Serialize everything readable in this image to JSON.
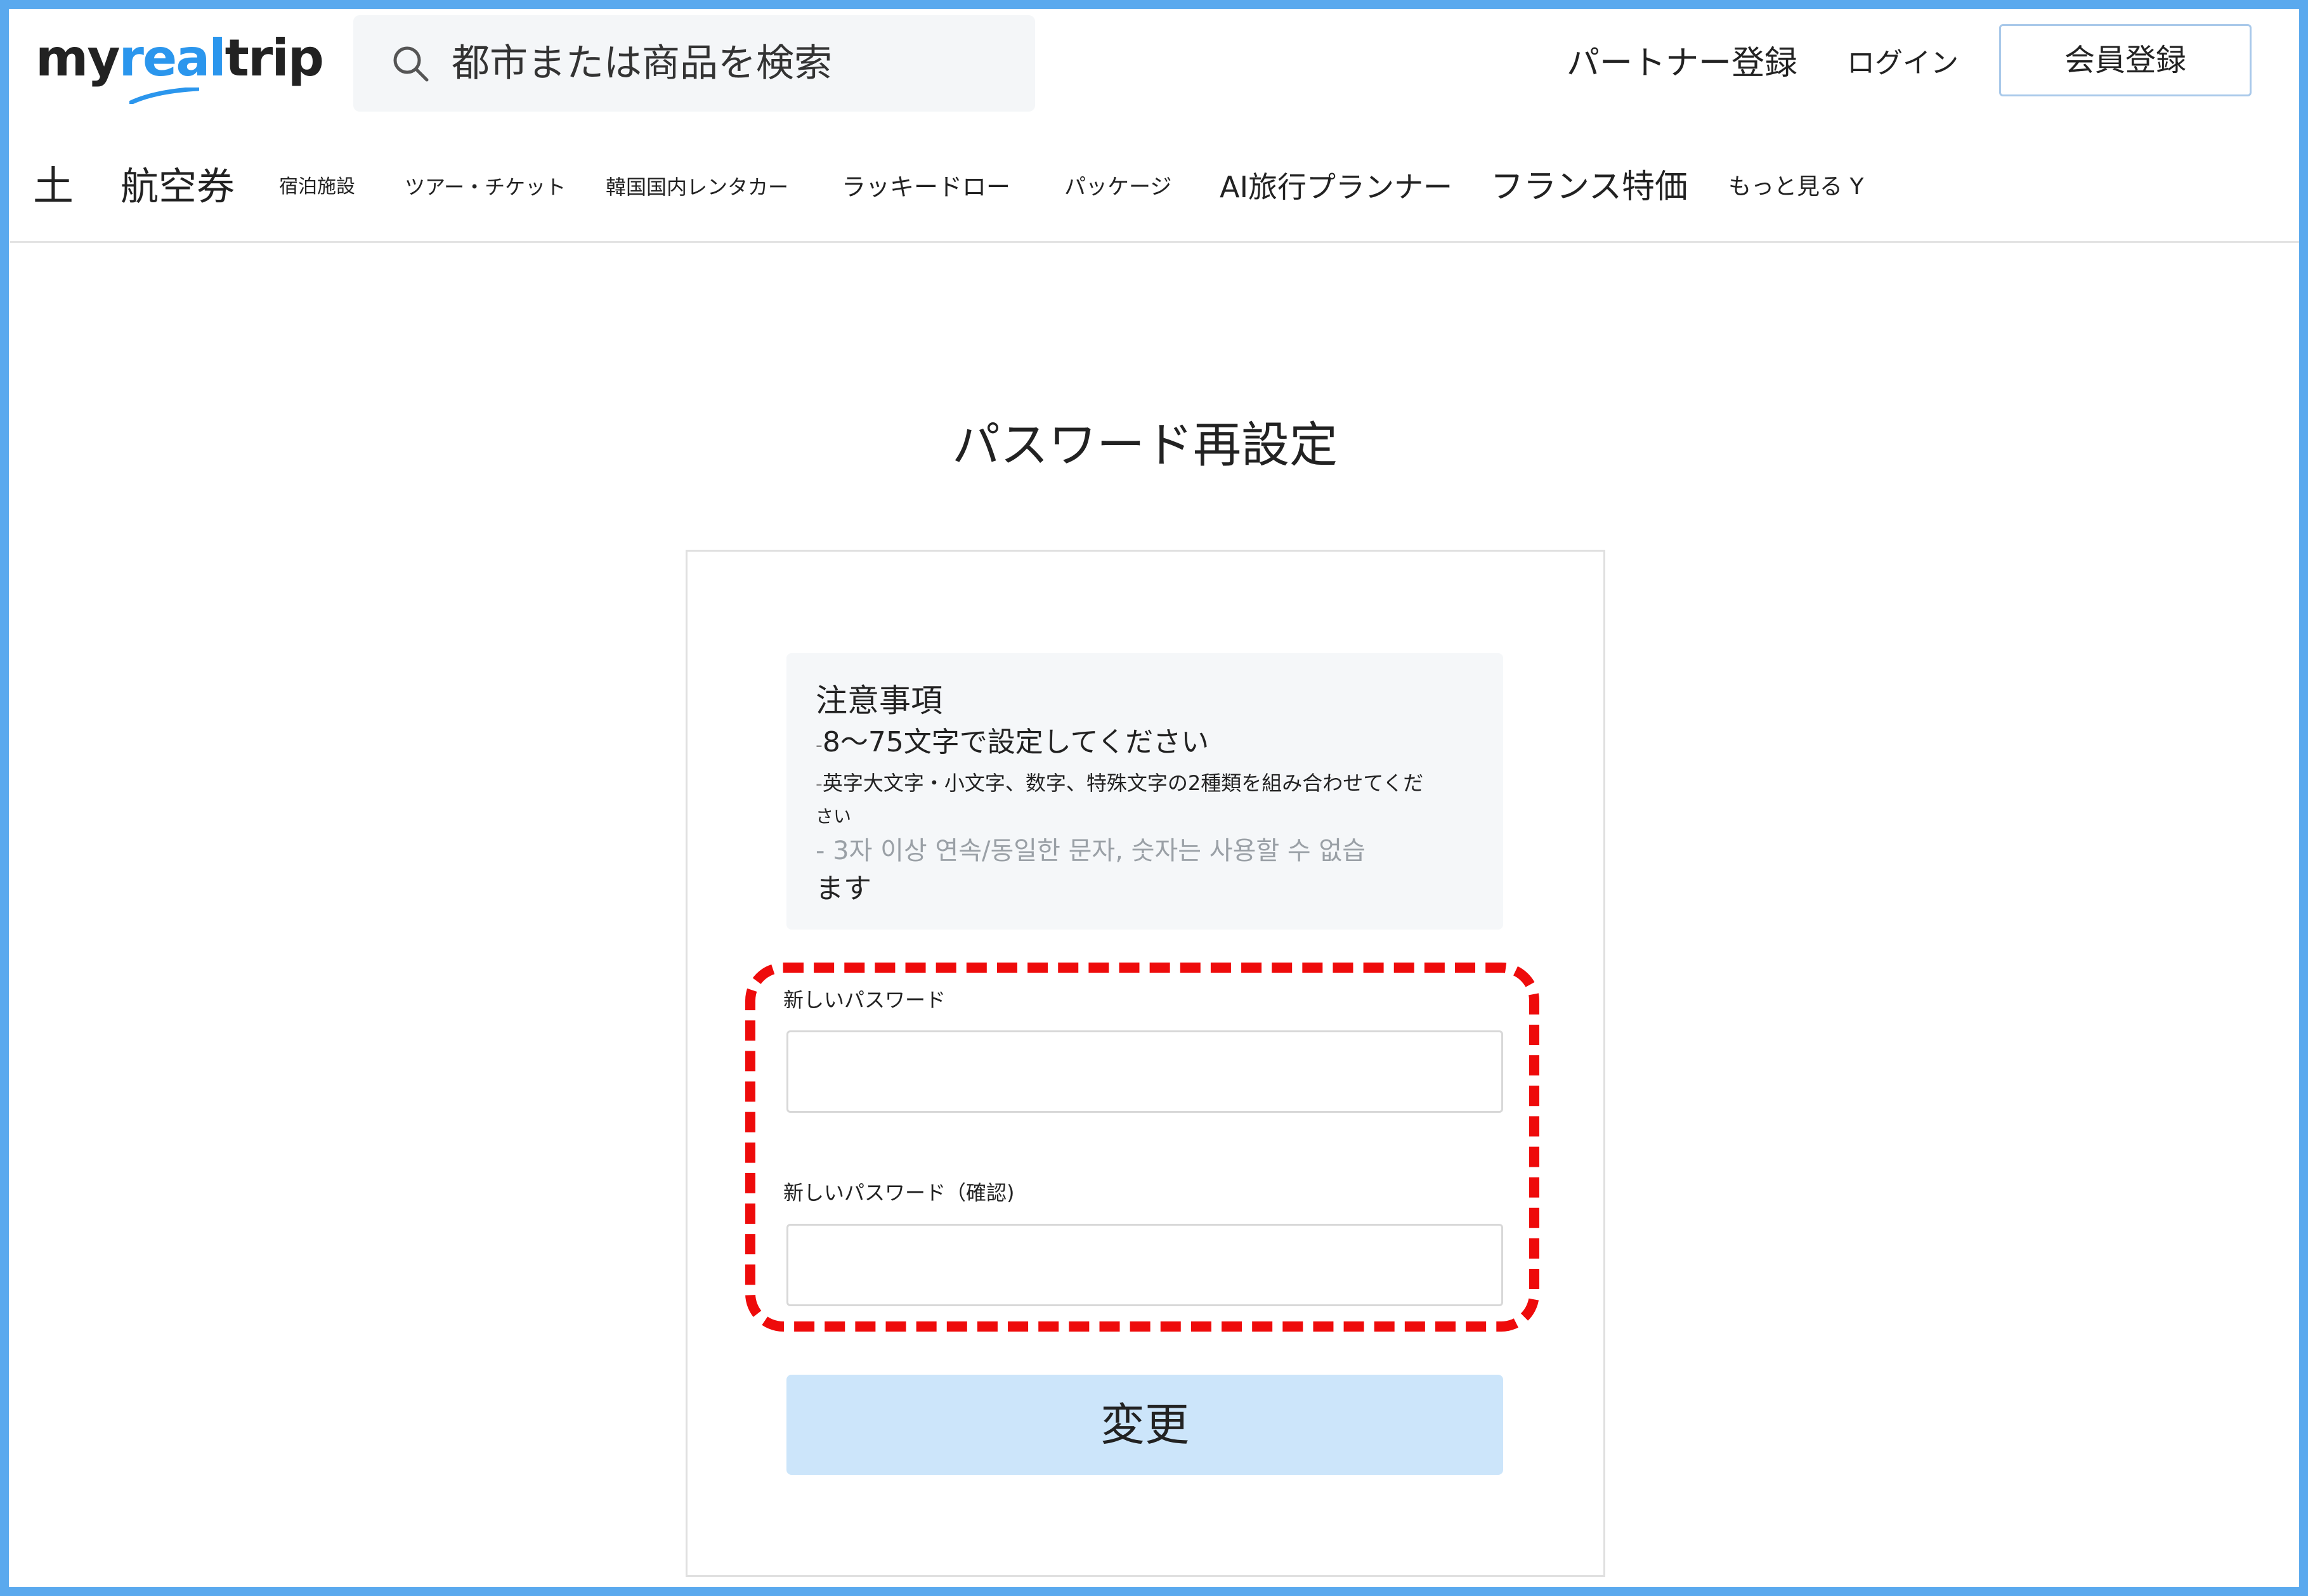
{
  "header": {
    "logo": {
      "part1": "my",
      "part2": "real",
      "part3": "trip"
    },
    "search": {
      "placeholder": "都市または商品を検索"
    },
    "partner_link": "パートナー登録",
    "login_link": "ログイン",
    "signup_button": "会員登録"
  },
  "nav": {
    "items": [
      {
        "label": "土"
      },
      {
        "label": "航空券"
      },
      {
        "label": "宿泊施設"
      },
      {
        "label": "ツアー・チケット"
      },
      {
        "label": "韓国国内レンタカー"
      },
      {
        "label": "ラッキードロー"
      },
      {
        "label": "パッケージ"
      },
      {
        "label": "AI旅行プランナー"
      },
      {
        "label": "フランス特価"
      },
      {
        "label": "もっと見る Y"
      }
    ]
  },
  "main": {
    "title": "パスワード再設定",
    "notice": {
      "title": "注意事項",
      "dash": "-",
      "line1": "8〜75文字で設定してください",
      "line2a": "英字大文字・小文字、数字、特殊文字の2種類を組み合わせてくだ",
      "line2b": "さい",
      "line3": "- 3자 이상 연속/동일한 문자, 숫자는 사용할 수 없습",
      "line4": "ます"
    },
    "new_password_label": "新しいパスワード",
    "confirm_password_label": "新しいパスワード（確認)",
    "submit_button": "変更"
  },
  "colors": {
    "frame": "#5aa9ee",
    "logo_accent": "#2b96ed",
    "highlight": "#ee0b0b",
    "submit_bg": "#cce5fa"
  }
}
